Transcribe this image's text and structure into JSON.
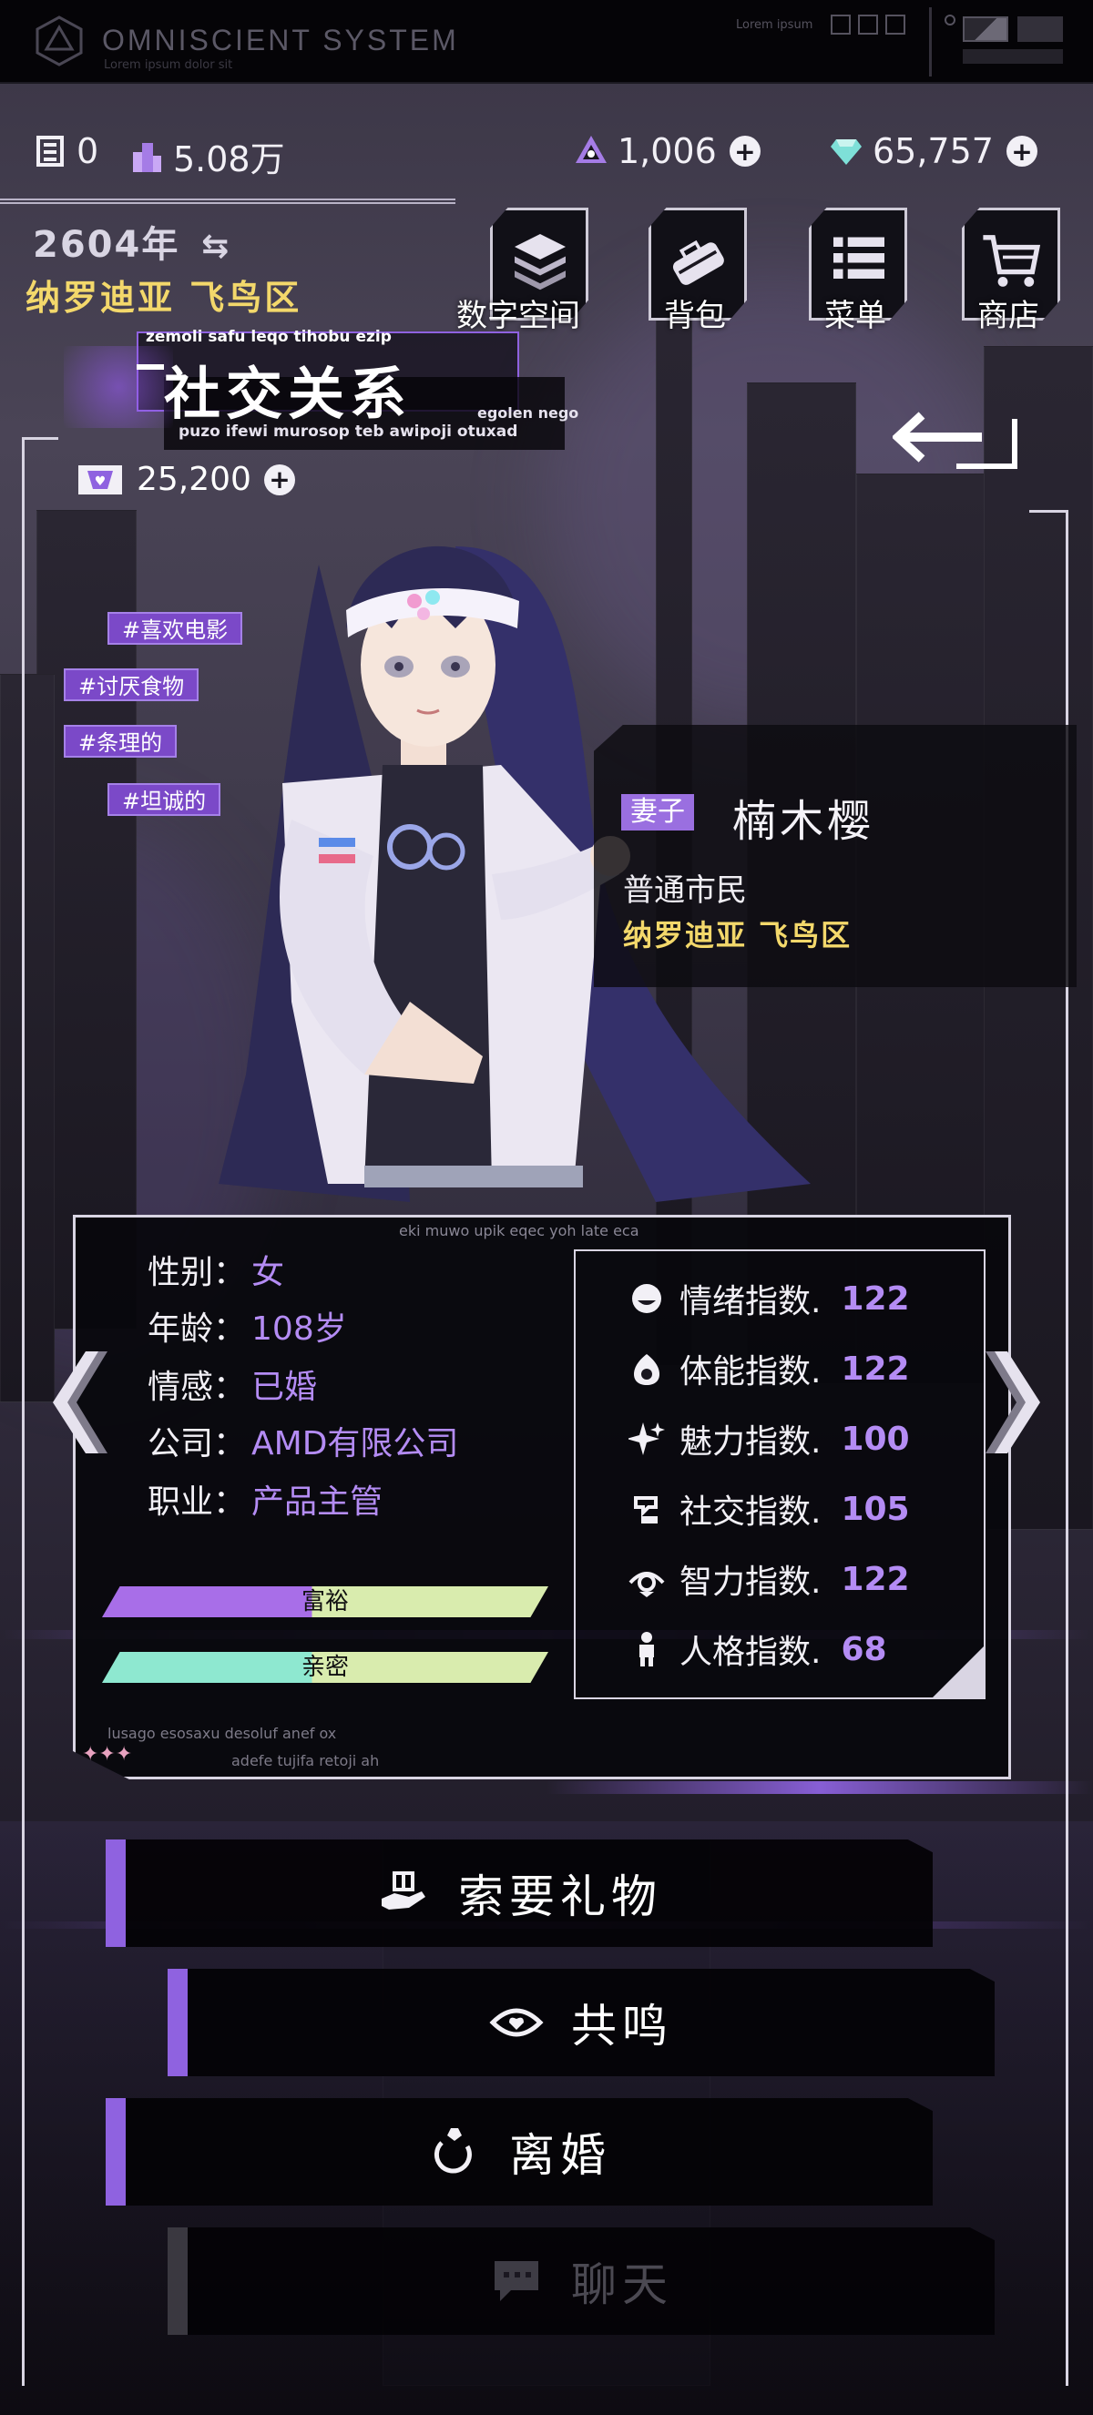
{
  "system": {
    "name": "OMNISCIENT SYSTEM",
    "subtitle": "Lorem ipsum dolor sit",
    "right_label": "Lorem ipsum"
  },
  "resources": {
    "chips": "0",
    "buildings": "5.08万",
    "crystals": "1,006",
    "gems": "65,757"
  },
  "location": {
    "year": "2604年",
    "district": "纳罗迪亚 飞鸟区"
  },
  "nav": [
    {
      "label": "数字空间",
      "icon": "layers-icon"
    },
    {
      "label": "背包",
      "icon": "bag-icon"
    },
    {
      "label": "菜单",
      "icon": "menu-list-icon"
    },
    {
      "label": "商店",
      "icon": "cart-icon"
    }
  ],
  "page": {
    "title": "社交关系",
    "small_top": "zemoli safu leqo tihobu ezip",
    "small_bottom": "puzo ifewi murosop teb awipoji otuxad",
    "small_right": "egolen nego"
  },
  "affinity": "25,200",
  "tags": [
    "#喜欢电影",
    "#讨厌食物",
    "#条理的",
    "#坦诚的"
  ],
  "character": {
    "role": "妻子",
    "name": "楠木樱",
    "status": "普通市民",
    "district": "纳罗迪亚 飞鸟区"
  },
  "panel": {
    "caption": "eki muwo upik eqec yoh late eca",
    "attributes": [
      {
        "label": "性别：",
        "value": "女"
      },
      {
        "label": "年龄：",
        "value": "108岁"
      },
      {
        "label": "情感：",
        "value": "已婚"
      },
      {
        "label": "公司：",
        "value": "AMD有限公司"
      },
      {
        "label": "职业：",
        "value": "产品主管"
      }
    ],
    "bars": [
      {
        "label": "富裕",
        "fill": 0.47,
        "colors": [
          "#a86ee8",
          "#d9ecae"
        ]
      },
      {
        "label": "亲密",
        "fill": 0.47,
        "colors": [
          "#8ee8d0",
          "#d9ecae"
        ]
      }
    ],
    "stats": [
      {
        "label": "情绪指数.",
        "value": "122",
        "icon": "mood-icon"
      },
      {
        "label": "体能指数.",
        "value": "122",
        "icon": "fitness-icon"
      },
      {
        "label": "魅力指数.",
        "value": "100",
        "icon": "sparkle-icon"
      },
      {
        "label": "社交指数.",
        "value": "105",
        "icon": "social-icon"
      },
      {
        "label": "智力指数.",
        "value": "122",
        "icon": "intellect-icon"
      },
      {
        "label": "人格指数.",
        "value": "68",
        "icon": "person-icon"
      }
    ],
    "footer1": "lusago esosaxu desoluf anef ox",
    "footer2": "adefe tujifa retoji ah"
  },
  "actions": [
    {
      "label": "索要礼物",
      "icon": "gift-hand-icon",
      "enabled": true
    },
    {
      "label": "共鸣",
      "icon": "eye-heart-icon",
      "enabled": true
    },
    {
      "label": "离婚",
      "icon": "broken-ring-icon",
      "enabled": true
    },
    {
      "label": "聊天",
      "icon": "chat-icon",
      "enabled": false
    }
  ],
  "colors": {
    "accent": "#8f62e0",
    "highlight": "#f3d86b",
    "stat_value": "#b48cf4"
  }
}
